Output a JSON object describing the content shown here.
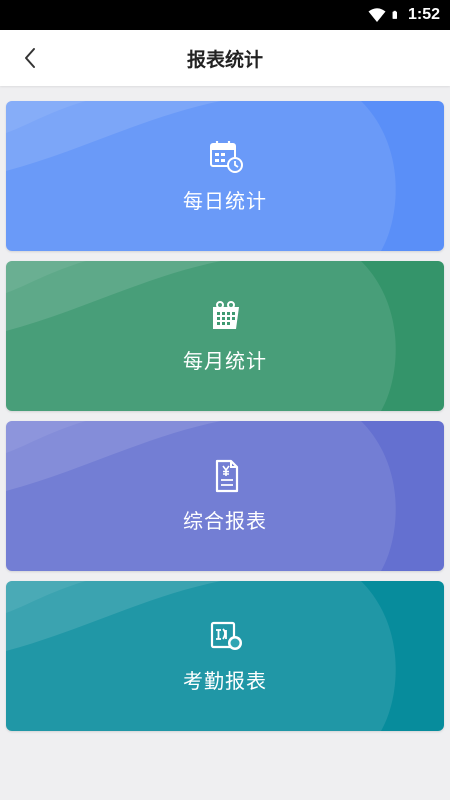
{
  "status_bar": {
    "time": "1:52",
    "icons": [
      "wifi-icon",
      "battery-icon"
    ]
  },
  "app_bar": {
    "title": "报表统计",
    "back_icon": "chevron-left-icon"
  },
  "cards": [
    {
      "label": "每日统计",
      "icon": "calendar-clock-icon",
      "color_dark": "#5a8ff8",
      "color_light": "#82aefb"
    },
    {
      "label": "每月统计",
      "icon": "calendar-month-icon",
      "color_dark": "#34946a",
      "color_light": "#6ab494"
    },
    {
      "label": "综合报表",
      "icon": "report-document-icon",
      "color_dark": "#6470d0",
      "color_light": "#9198e0"
    },
    {
      "label": "考勤报表",
      "icon": "attendance-report-icon",
      "color_dark": "#078c9c",
      "color_light": "#4fb5c1"
    }
  ]
}
